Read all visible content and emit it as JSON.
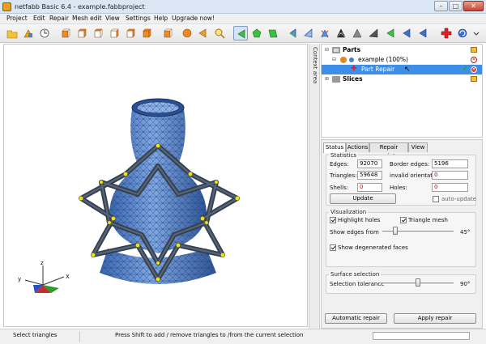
{
  "window": {
    "title": "netfabb Basic 6.4 - example.fabbproject"
  },
  "menu": [
    "Project",
    "Edit",
    "Repair",
    "Mesh edit",
    "View",
    "Settings",
    "Help",
    "Upgrade now!"
  ],
  "sidebar_label": "Context area",
  "tree": {
    "parts": "Parts",
    "example": "example (100%)",
    "part_repair": "Part Repair",
    "slices": "Slices"
  },
  "tabs": [
    "Status",
    "Actions",
    "Repair scripts",
    "View"
  ],
  "statistics": {
    "title": "Statistics",
    "edges_label": "Edges:",
    "edges_value": "92070",
    "border_edges_label": "Border edges:",
    "border_edges_value": "5196",
    "triangles_label": "Triangles:",
    "triangles_value": "59648",
    "invalid_orientation_label": "invalid orientation",
    "invalid_orientation_value": "0",
    "shells_label": "Shells:",
    "shells_value": "0",
    "holes_label": "Holes:",
    "holes_value": "0",
    "update_button": "Update",
    "auto_update_label": "auto-update"
  },
  "visualization": {
    "title": "Visualization",
    "highlight_holes": "Highlight holes",
    "triangle_mesh": "Triangle mesh",
    "show_edges_from": "Show edges from",
    "show_edges_value": "45°",
    "show_edges_level": 0.16,
    "show_degenerated": "Show degenerated faces"
  },
  "surface": {
    "title": "Surface selection",
    "tolerance_label": "Selection tolerance",
    "tolerance_value": "90°",
    "tolerance_level": 0.5
  },
  "buttons": {
    "automatic_repair": "Automatic repair",
    "apply_repair": "Apply repair"
  },
  "status_bar": {
    "left": "Select triangles",
    "message": "Press Shift to add / remove triangles to /from the current selection"
  },
  "axes": {
    "x": "X",
    "y": "y",
    "z": "z"
  },
  "colors": {
    "selection": "#3d8ee6",
    "mesh_blue": "#5a8fd6",
    "error_red": "#d40000"
  }
}
